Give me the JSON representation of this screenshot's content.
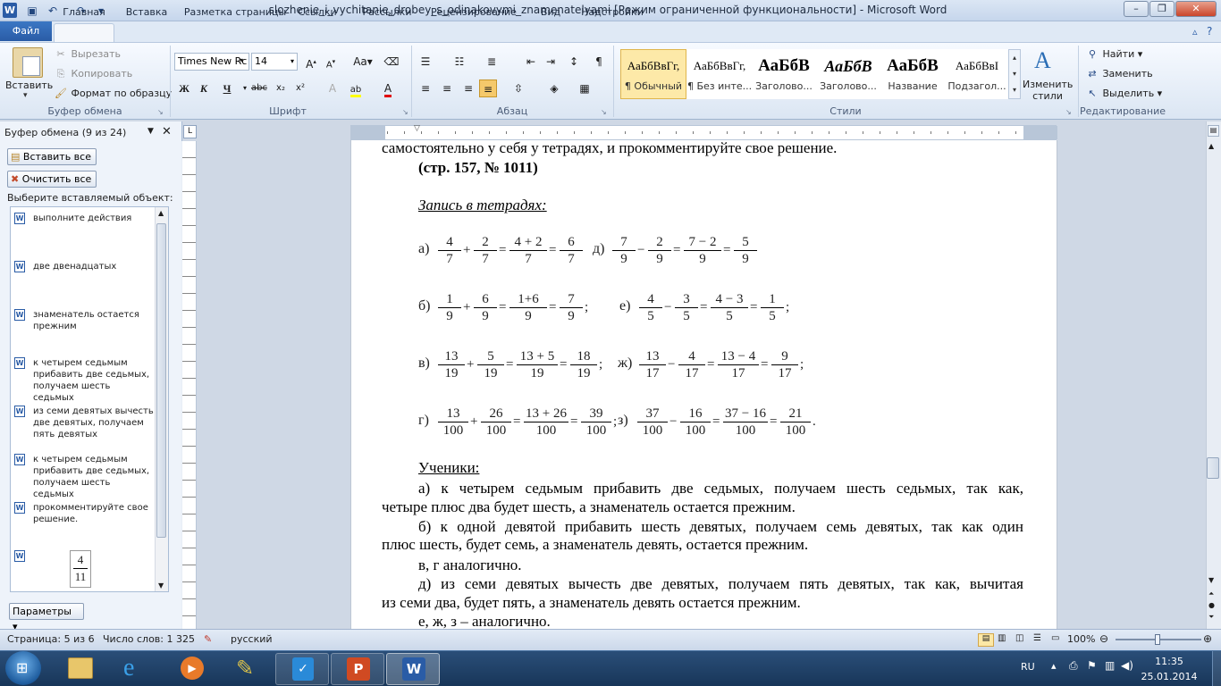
{
  "window": {
    "title": "slozhenie_i_vychitanie_drobey_s_odinakovymi_znamenatelyami [Режим ограниченной функциональности]  -  Microsoft Word"
  },
  "qat": {
    "save_icon": "save-icon",
    "undo_icon": "undo-icon",
    "redo_icon": "redo-icon"
  },
  "tabs": [
    "Файл",
    "Главная",
    "Вставка",
    "Разметка страницы",
    "Ссылки",
    "Рассылки",
    "Рецензирование",
    "Вид",
    "Надстройки"
  ],
  "ribbon": {
    "clipboard": {
      "paste": "Вставить",
      "cut": "Вырезать",
      "copy": "Копировать",
      "format_painter": "Формат по образцу",
      "label": "Буфер обмена"
    },
    "font": {
      "name": "Times New Rc",
      "size": "14",
      "label": "Шрифт"
    },
    "paragraph": {
      "label": "Абзац"
    },
    "styles": {
      "label": "Стили",
      "items": [
        {
          "sample": "АаБбВвГг,",
          "name": "¶ Обычный"
        },
        {
          "sample": "АаБбВвГг,",
          "name": "¶ Без инте..."
        },
        {
          "sample": "АаБбВ",
          "name": "Заголово..."
        },
        {
          "sample": "АаБбВ",
          "name": "Заголово..."
        },
        {
          "sample": "АаБбВ",
          "name": "Название"
        },
        {
          "sample": "АаБбВвІ",
          "name": "Подзагол..."
        }
      ],
      "change_styles": "Изменить стили"
    },
    "editing": {
      "find": "Найти",
      "replace": "Заменить",
      "select": "Выделить",
      "label": "Редактирование"
    }
  },
  "clipboard_pane": {
    "title": "Буфер обмена (9 из 24)",
    "paste_all": "Вставить все",
    "clear_all": "Очистить все",
    "prompt": "Выберите вставляемый объект:",
    "items": [
      "выполните действия",
      "две двенадцатых",
      "знаменатель остается прежним",
      "к четырем седьмым прибавить две седьмых, получаем шесть седьмых",
      "из семи девятых вычесть две девятых, получаем пять девятых",
      "к четырем седьмым прибавить две седьмых, получаем шесть седьмых",
      "прокомментируйте свое решение."
    ],
    "fraction_item": {
      "num": "4",
      "den": "11"
    },
    "options": "Параметры"
  },
  "document": {
    "line_top": "самостоятельно у себя у тетрадях, и прокомментируйте свое решение.",
    "ref": "(стр. 157, № 1011)",
    "heading": "Запись в тетрадях:",
    "examples": {
      "a": {
        "label": "а)",
        "f": [
          [
            "4",
            "7"
          ],
          [
            "2",
            "7"
          ],
          [
            "4 + 2",
            "7"
          ],
          [
            "6",
            "7"
          ]
        ],
        "ops": [
          "+",
          "=",
          "="
        ],
        "end": ""
      },
      "d": {
        "label": "д)",
        "f": [
          [
            "7",
            "9"
          ],
          [
            "2",
            "9"
          ],
          [
            "7 − 2",
            "9"
          ],
          [
            "5",
            "9"
          ]
        ],
        "ops": [
          "−",
          "=",
          "="
        ],
        "end": ""
      },
      "b": {
        "label": "б)",
        "f": [
          [
            "1",
            "9"
          ],
          [
            "6",
            "9"
          ],
          [
            "1+6",
            "9"
          ],
          [
            "7",
            "9"
          ]
        ],
        "ops": [
          "+",
          "=",
          "="
        ],
        "end": ";"
      },
      "e": {
        "label": "е)",
        "f": [
          [
            "4",
            "5"
          ],
          [
            "3",
            "5"
          ],
          [
            "4 − 3",
            "5"
          ],
          [
            "1",
            "5"
          ]
        ],
        "ops": [
          "−",
          "=",
          "="
        ],
        "end": ";"
      },
      "v": {
        "label": "в)",
        "f": [
          [
            "13",
            "19"
          ],
          [
            "5",
            "19"
          ],
          [
            "13 + 5",
            "19"
          ],
          [
            "18",
            "19"
          ]
        ],
        "ops": [
          "+",
          "=",
          "="
        ],
        "end": ";"
      },
      "zh": {
        "label": "ж)",
        "f": [
          [
            "13",
            "17"
          ],
          [
            "4",
            "17"
          ],
          [
            "13 − 4",
            "17"
          ],
          [
            "9",
            "17"
          ]
        ],
        "ops": [
          "−",
          "=",
          "="
        ],
        "end": ";"
      },
      "g": {
        "label": "г)",
        "f": [
          [
            "13",
            "100"
          ],
          [
            "26",
            "100"
          ],
          [
            "13 + 26",
            "100"
          ],
          [
            "39",
            "100"
          ]
        ],
        "ops": [
          "+",
          "=",
          "="
        ],
        "end": ";"
      },
      "z": {
        "label": "з)",
        "f": [
          [
            "37",
            "100"
          ],
          [
            "16",
            "100"
          ],
          [
            "37 − 16",
            "100"
          ],
          [
            "21",
            "100"
          ]
        ],
        "ops": [
          "−",
          "=",
          "="
        ],
        "end": "."
      }
    },
    "students_heading": "Ученики:",
    "paragraphs": [
      "а) к четырем седьмым прибавить две седьмых, получаем шесть седьмых, так как,",
      "четыре плюс два будет шесть, а знаменатель остается прежним.",
      "б) к одной девятой прибавить шесть девятых, получаем семь девятых, так как один",
      "плюс шесть, будет семь, а знаменатель девять, остается прежним.",
      "в, г аналогично.",
      "д) из семи девятых вычесть две девятых, получаем пять девятых, так как, вычитая",
      "из семи два, будет пять, а знаменатель девять остается прежним.",
      "е, ж, з – аналогично."
    ]
  },
  "status": {
    "page": "Страница: 5 из 6",
    "words": "Число слов: 1 325",
    "language": "русский",
    "zoom": "100%"
  },
  "taskbar": {
    "lang": "RU",
    "time": "11:35",
    "date": "25.01.2014"
  }
}
